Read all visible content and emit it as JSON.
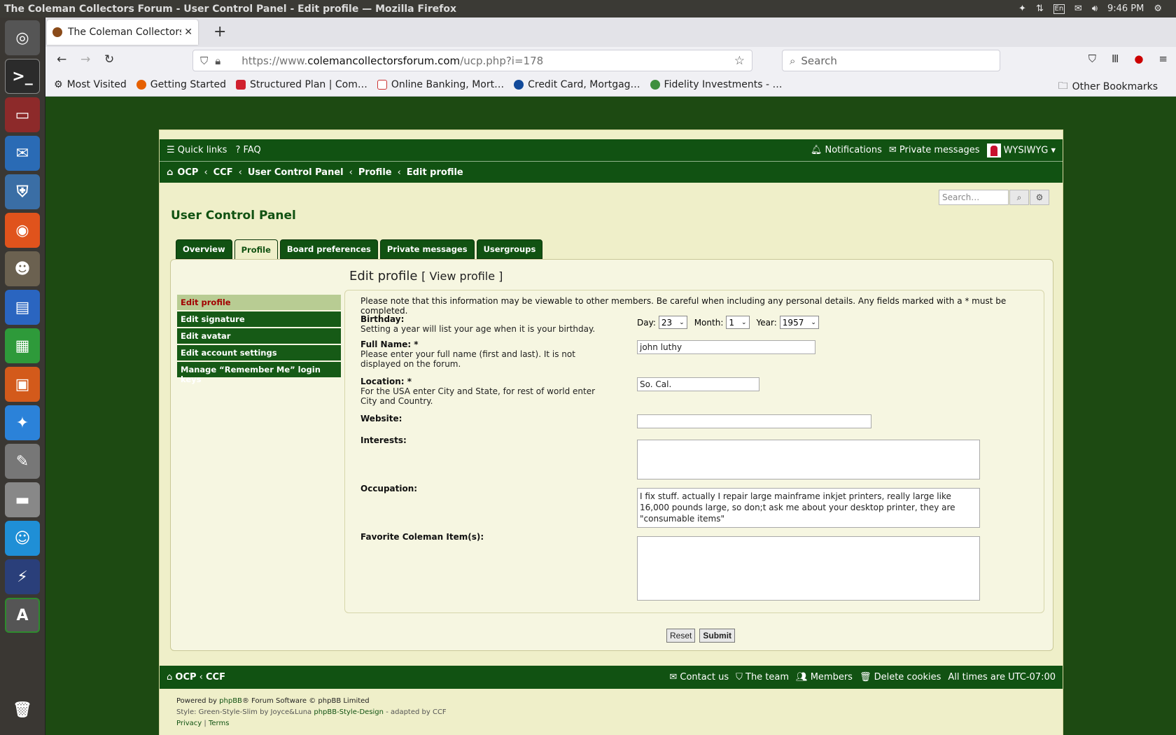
{
  "os": {
    "window_title": "The Coleman Collectors Forum - User Control Panel - Edit profile — Mozilla Firefox",
    "lang": "En",
    "time": "9:46 PM"
  },
  "browser": {
    "tab_title": "The Coleman Collectors F",
    "url_prefix": "https://www.",
    "url_domain": "colemancollectorsforum.com",
    "url_path": "/ucp.php?i=178",
    "search_placeholder": "Search",
    "bookmarks": [
      "Most Visited",
      "Getting Started",
      "Structured Plan | Com…",
      "Online Banking, Mort…",
      "Credit Card, Mortgag…",
      "Fidelity Investments - …"
    ],
    "other_bookmarks": "Other Bookmarks"
  },
  "forum": {
    "quick_links": "Quick links",
    "faq": "FAQ",
    "notifications": "Notifications",
    "private_messages": "Private messages",
    "username": "WYSIWYG",
    "breadcrumb": [
      "OCP",
      "CCF",
      "User Control Panel",
      "Profile",
      "Edit profile"
    ],
    "search_placeholder": "Search…",
    "ucp_title": "User Control Panel",
    "tabs": [
      "Overview",
      "Profile",
      "Board preferences",
      "Private messages",
      "Usergroups"
    ],
    "page_title": "Edit profile",
    "view_profile": "[ View profile ]",
    "side": [
      "Edit profile",
      "Edit signature",
      "Edit avatar",
      "Edit account settings",
      "Manage “Remember Me” login keys"
    ],
    "note": "Please note that this information may be viewable to other members. Be careful when including any personal details. Any fields marked with a * must be completed.",
    "birthday": {
      "label": "Birthday:",
      "desc": "Setting a year will list your age when it is your birthday.",
      "day_label": "Day:",
      "day": "23",
      "month_label": "Month:",
      "month": "1",
      "year_label": "Year:",
      "year": "1957"
    },
    "fullname": {
      "label": "Full Name: *",
      "desc": "Please enter your full name (first and last). It is not displayed on the forum.",
      "value": "john luthy"
    },
    "location": {
      "label": "Location: *",
      "desc": "For the USA enter City and State, for rest of world enter City and Country.",
      "value": "So. Cal."
    },
    "website": {
      "label": "Website:",
      "value": ""
    },
    "interests": {
      "label": "Interests:",
      "value": ""
    },
    "occupation": {
      "label": "Occupation:",
      "value": "I fix stuff. actually I repair large mainframe inkjet printers, really large like 16,000 pounds large, so don;t ask me about your desktop printer, they are \"consumable items\""
    },
    "favorite": {
      "label": "Favorite Coleman Item(s):",
      "value": ""
    },
    "reset": "Reset",
    "submit": "Submit",
    "footer_links": [
      "Contact us",
      "The team",
      "Members",
      "Delete cookies"
    ],
    "timezone": "All times are UTC-07:00",
    "powered": "Powered by",
    "phpbb": "phpBB",
    "powered_rest": "® Forum Software © phpBB Limited",
    "style_line": "Style: Green-Style-Slim by Joyce&Luna",
    "style_link": "phpBB-Style-Design",
    "adapted": "- adapted by CCF",
    "privacy": "Privacy",
    "terms": "Terms"
  },
  "colors": {
    "forum_green": "#115212",
    "page_bg": "#1d4a12",
    "cream": "#efefc9"
  }
}
